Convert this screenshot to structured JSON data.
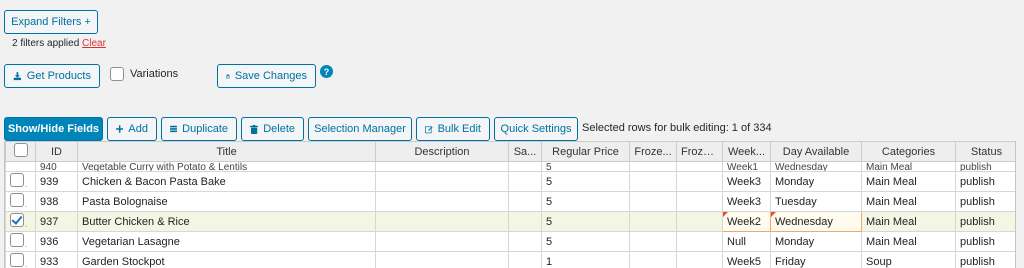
{
  "filters": {
    "expand_label": "Expand Filters +",
    "applied_text": "2 filters applied",
    "clear_label": "Clear"
  },
  "actions": {
    "get_products_label": "Get Products",
    "variations_label": "Variations",
    "save_changes_label": "Save Changes",
    "help_label": "?"
  },
  "toolbar": {
    "show_hide_label": "Show/Hide Fields",
    "add_label": "Add",
    "duplicate_label": "Duplicate",
    "delete_label": "Delete",
    "selection_manager_label": "Selection Manager",
    "bulk_edit_label": "Bulk Edit",
    "quick_settings_label": "Quick Settings",
    "selected_rows_text": "Selected rows for bulk editing: 1 of 334"
  },
  "table": {
    "columns": [
      "ID",
      "Title",
      "Description",
      "Sa...",
      "Regular Price",
      "Froze...",
      "Froze...",
      "Week...",
      "Day Available",
      "Categories",
      "Status"
    ],
    "partial_row": {
      "id": "940",
      "title": "Vegetable Curry with Potato & Lentils",
      "price": "5",
      "week": "Week1",
      "day": "Wednesday",
      "category": "Main Meal",
      "status": "publish"
    },
    "rows": [
      {
        "id": "939",
        "title": "Chicken & Bacon Pasta Bake",
        "price": "5",
        "week": "Week3",
        "day": "Monday",
        "category": "Main Meal",
        "status": "publish",
        "checked": false
      },
      {
        "id": "938",
        "title": "Pasta Bolognaise",
        "price": "5",
        "week": "Week3",
        "day": "Tuesday",
        "category": "Main Meal",
        "status": "publish",
        "checked": false
      },
      {
        "id": "937",
        "title": "Butter Chicken & Rice",
        "price": "5",
        "week": "Week2",
        "day": "Wednesday",
        "category": "Main Meal",
        "status": "publish",
        "checked": true
      },
      {
        "id": "936",
        "title": "Vegetarian Lasagne",
        "price": "5",
        "week": "Null",
        "day": "Monday",
        "category": "Main Meal",
        "status": "publish",
        "checked": false
      },
      {
        "id": "933",
        "title": "Garden Stockpot",
        "price": "1",
        "week": "Week5",
        "day": "Friday",
        "category": "Soup",
        "status": "publish",
        "checked": false
      }
    ]
  }
}
